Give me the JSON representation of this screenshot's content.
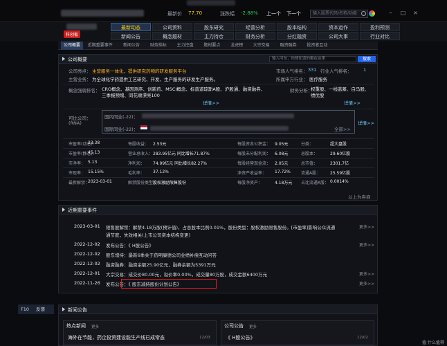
{
  "topbar": {
    "price": "77.70",
    "change_pct": "-2.88%",
    "btn_prev": "上一个",
    "btn_next": "下一个",
    "search_placeholder": "输入股票代码/名称/功能",
    "label_price": "最新价",
    "label_change": "涨跌幅"
  },
  "nav": {
    "stock_tag": "科创板",
    "row1": [
      "最新动态",
      "公司资料",
      "股东研究",
      "经营分析",
      "股本结构",
      "资本运作",
      "盈利预测"
    ],
    "row2": [
      "新闻公告",
      "概念题材",
      "主力持仓",
      "财务分析",
      "分红融资",
      "公司大事",
      "行业对比"
    ],
    "active": "最新动态"
  },
  "subtabs": [
    "公司概要",
    "近期重要事件",
    "新闻公告",
    "财务指标",
    "主力控盘",
    "题材要点",
    "龙虎榜",
    "大宗交易",
    "融资融券",
    "投资者互动"
  ],
  "subtab_active": "公司概要",
  "panel1": {
    "title": "公司概要",
    "search_placeholder": "输入问句，你想知道的都在这里",
    "search_btn": "搜索",
    "rows": {
      "highlight_label": "公司亮点：",
      "highlight_value": "主营服务一体化，提供研究药物的研发服务平台",
      "business_label": "主营业务：",
      "business_value": "为全球化学药提供工艺研究、开发、生产服务的研发生产服务。",
      "concept_label": "概念强弱排名：",
      "concept_value": "CRO概念、基因测序、创新药、MSCI概念、标普道琼斯A股、沪股通、融资融券、三季报预增、同花顺漂亮100",
      "concept_more": "详情>>",
      "industry_count_label": "市场人气排名：",
      "industry_count_value": "331",
      "industry_rank_label": "行业人气排名：",
      "industry_rank_value": "1",
      "sector_label": "所属申万行业：",
      "sector_value": "医疗服务",
      "finance_label": "财务分析：",
      "finance_value": "权重股、一线蓝筹、白马股、绩优股",
      "finance_more": "详情>>",
      "products_label": "可比公司：",
      "products_sublabel": "(RNA)",
      "products_line1_label": "国内同业(-22)：",
      "products_line2_label": "国际同业(-22)：",
      "products_more": "详情>>",
      "products_all": "全部>>"
    },
    "metrics": [
      [
        "市盈率(动态)：",
        "23.38",
        "每股收益：",
        "2.53元",
        "每股资本公积金：",
        "9.05元",
        "分类：",
        "超大盘股"
      ],
      [
        "市盈率(静态)：",
        "45.13",
        "营业总收入：",
        "283.95亿元  同比增长71.87%",
        "每股未分配利润：",
        "6.08元",
        "总股本：",
        "29.60亿股"
      ],
      [
        "市净率：",
        "5.13",
        "净利润：",
        "74.99亿元  同比增长82.27%",
        "每股经营现金流：",
        "2.05元",
        "总市值：",
        "2301.7亿"
      ],
      [
        "市现率：",
        "15.15%",
        "毛利率：",
        "37.12%",
        "净资产收益率：",
        "17.72%",
        "流通A股：",
        "25.59亿股"
      ],
      [
        "最新解禁：",
        "2023-03-01",
        "解禁股份类型：",
        "股权激励限售股份",
        "每股净资产：",
        "4.18万元",
        "占比流通A股：",
        "0.0014%"
      ]
    ],
    "footer": "以上为券商"
  },
  "panel2": {
    "title": "近期重要事件",
    "events": [
      {
        "date": "2023-03-01",
        "text": "限售股解禁：解禁4.18万股(预计值)，占总股本比例0.01%，股份类型：股权激励限售股份。[市盈率]影响公众流通",
        "more": "更多>>"
      },
      {
        "date": "",
        "text": "通节度，失效相关(上市公司资本结构变更)",
        "more": ""
      },
      {
        "date": "2022-12-02",
        "text": "发布公告：《                H股公告》",
        "more": "更多>>"
      },
      {
        "date": "2022-12-02",
        "text": "股东增持：最新6季关于药明康德公司业绩补偿互动问答",
        "more": ""
      },
      {
        "date": "2022-12-02",
        "text": "融资融券：融资余额25.90亿元，融券余额为5391万元",
        "more": ""
      },
      {
        "date": "2022-12-01",
        "text": "大宗交易：成交价80.00元，溢价率0.00%，成交量80万股，成交金额6400万元",
        "more": "更多>>"
      },
      {
        "date": "2022-11-26",
        "text": "发布公告：《              股东减持股份计划公告》",
        "more": "更多>>"
      }
    ]
  },
  "panel3": {
    "title": "新闻公告",
    "side_tab_left": "F10",
    "side_tab_right": "反馈",
    "cards": [
      {
        "title": "热点新闻",
        "more": "更多",
        "line": "海外在节能，药企投资建设能生产线已成常态",
        "date": "12/03"
      },
      {
        "title": "公司公告",
        "more": "更多",
        "line": "《               H股公告》",
        "date": "12/02"
      }
    ]
  },
  "watermark": "值 什么值得买",
  "colors": {
    "up": "#ff3b3b",
    "down": "#22c55e",
    "accent": "#ffd200",
    "highlight_box": "#ef1c1c"
  }
}
